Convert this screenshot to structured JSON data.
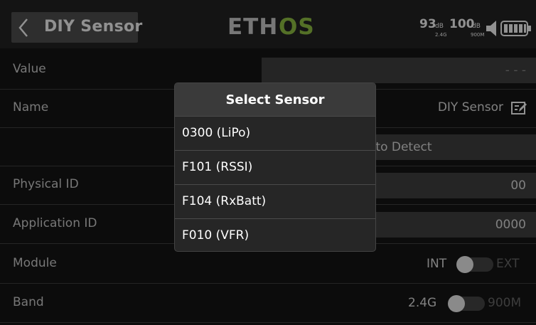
{
  "header": {
    "title": "DIY Sensor",
    "logo_left": "ETH",
    "logo_right": "OS",
    "status": {
      "rssi1_value": "93",
      "rssi1_unit": "dB",
      "rssi1_band": "2.4G",
      "rssi2_value": "100",
      "rssi2_unit": "dB",
      "rssi2_band": "900M"
    }
  },
  "rows": {
    "value": {
      "label": "Value",
      "value": "- - -"
    },
    "name": {
      "label": "Name",
      "value": "DIY Sensor"
    },
    "auto_detect": {
      "value": "Auto Detect"
    },
    "physical_id": {
      "label": "Physical ID",
      "value": "00"
    },
    "application_id": {
      "label": "Application ID",
      "value": "0000"
    },
    "module": {
      "label": "Module",
      "left": "INT",
      "right": "EXT"
    },
    "band": {
      "label": "Band",
      "left": "2.4G",
      "right": "900M"
    }
  },
  "dialog": {
    "title": "Select Sensor",
    "options": [
      "0300 (LiPo)",
      "F101 (RSSI)",
      "F104 (RxBatt)",
      "F010 (VFR)"
    ]
  },
  "colors": {
    "accent_green": "#8fc33e",
    "background": "#0c0c0c",
    "dialog_bg": "#262626"
  }
}
